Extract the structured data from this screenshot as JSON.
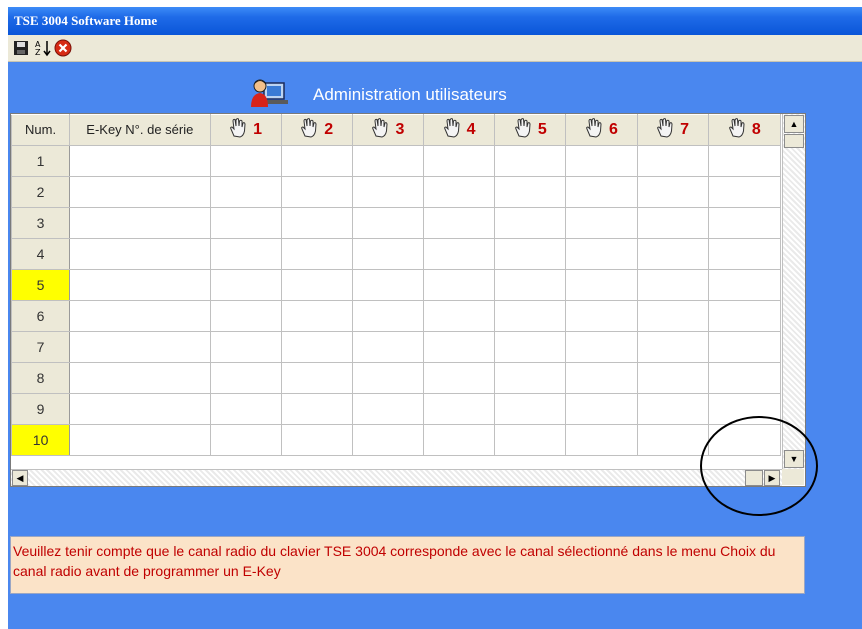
{
  "window": {
    "title": "TSE 3004 Software Home"
  },
  "toolbar": {
    "buttons": [
      "save-icon",
      "sort-az-icon",
      "close-red-icon"
    ]
  },
  "header": {
    "title": "Administration utilisateurs",
    "icon": "user-computer-icon"
  },
  "grid": {
    "col_num_label": "Num.",
    "col_key_label": "E-Key N°. de série",
    "channel_columns": [
      "1",
      "2",
      "3",
      "4",
      "5",
      "6",
      "7",
      "8"
    ],
    "rows": [
      "1",
      "2",
      "3",
      "4",
      "5",
      "6",
      "7",
      "8",
      "9",
      "10"
    ],
    "highlighted_rows": [
      "5",
      "10"
    ],
    "highlight_color": "#ffff00"
  },
  "message": {
    "text": "Veuillez tenir compte que le canal radio du clavier TSE 3004 corresponde avec le canal sélectionné dans le menu Choix du canal radio avant de programmer un E-Key",
    "color": "#c00000",
    "background": "#fbe3c8"
  }
}
